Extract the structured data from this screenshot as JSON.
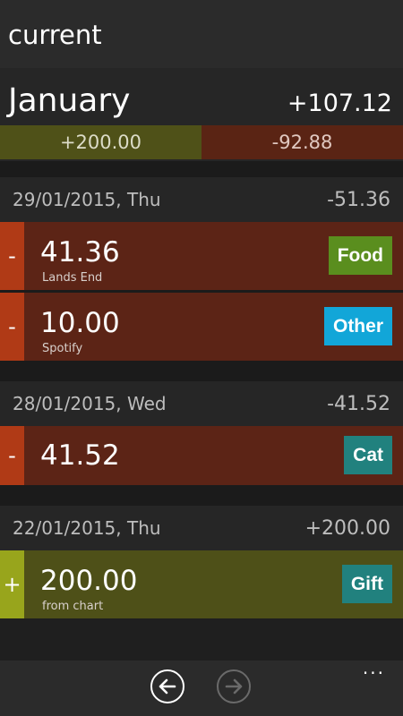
{
  "header": {
    "title": "current"
  },
  "month": {
    "name": "January",
    "total": "+107.12",
    "income": "+200.00",
    "expense": "-92.88"
  },
  "days": [
    {
      "date": "29/01/2015, Thu",
      "sum": "-51.36",
      "transactions": [
        {
          "sign": "-",
          "amount": "41.36",
          "note": "Lands End",
          "category": "Food",
          "category_color": "#5a8e1e"
        },
        {
          "sign": "-",
          "amount": "10.00",
          "note": "Spotify",
          "category": "Other",
          "category_color": "#12a6d8"
        }
      ]
    },
    {
      "date": "28/01/2015, Wed",
      "sum": "-41.52",
      "transactions": [
        {
          "sign": "-",
          "amount": "41.52",
          "note": "",
          "category": "Cat",
          "category_color": "#21817e"
        }
      ]
    },
    {
      "date": "22/01/2015, Thu",
      "sum": "+200.00",
      "transactions": [
        {
          "sign": "+",
          "amount": "200.00",
          "note": "from chart",
          "category": "Gift",
          "category_color": "#21817e"
        }
      ]
    }
  ],
  "appbar": {
    "back_icon": "arrow-left-icon",
    "forward_icon": "arrow-right-icon",
    "more_label": "..."
  }
}
